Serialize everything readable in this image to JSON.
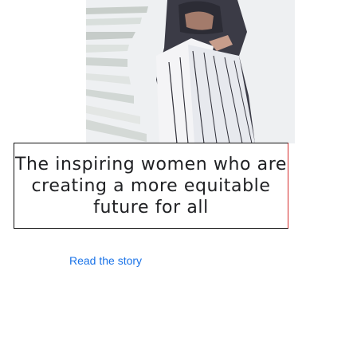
{
  "story": {
    "headline": "The inspiring women who are creating a more equitable future for all",
    "cta_label": "Read the story"
  },
  "colors": {
    "link": "#1a73e8",
    "headline": "#202124",
    "box_border": "#111111",
    "box_border_right": "#d62d2d"
  }
}
